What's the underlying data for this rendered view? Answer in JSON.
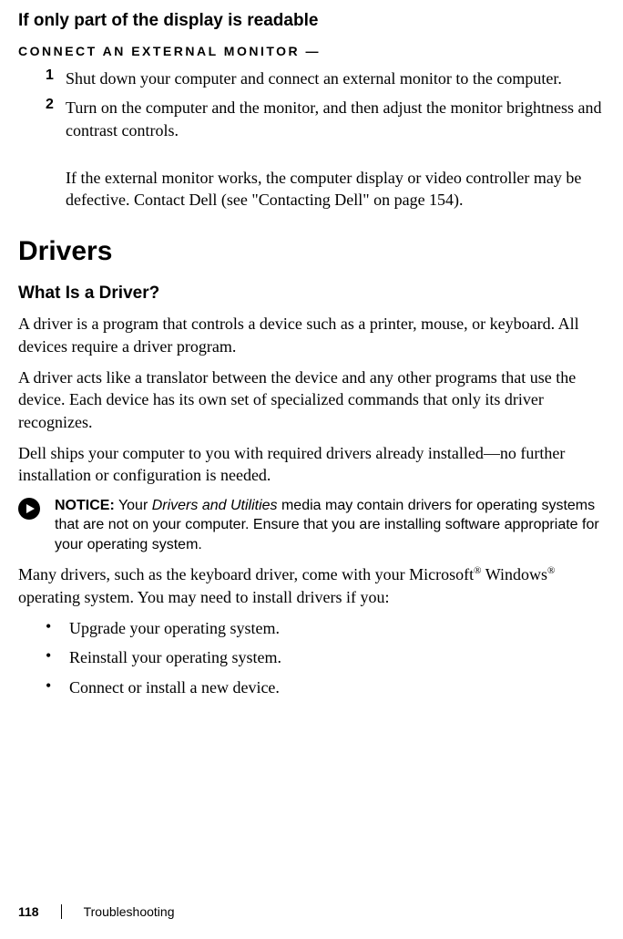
{
  "heading_sub": "If only part of the display is readable",
  "action_head": "Connect an external monitor —",
  "steps": [
    {
      "num": "1",
      "text": "Shut down your computer and connect an external monitor to the computer."
    },
    {
      "num": "2",
      "text": "Turn on the computer and the monitor, and then adjust the monitor brightness and contrast controls."
    }
  ],
  "step_followup": "If the external monitor works, the computer display or video controller may be defective. Contact Dell (see \"Contacting Dell\" on page 154).",
  "section_h1": "Drivers",
  "section_h2": "What Is a Driver?",
  "paras": [
    "A driver is a program that controls a device such as a printer, mouse, or keyboard. All devices require a driver program.",
    "A driver acts like a translator between the device and any other programs that use the device. Each device has its own set of specialized commands that only its driver recognizes.",
    "Dell ships your computer to you with required drivers already installed—no further installation or configuration is needed."
  ],
  "notice_label": "NOTICE:",
  "notice_text_pre": " Your ",
  "notice_italic": "Drivers and Utilities",
  "notice_text_post": " media may contain drivers for operating systems that are not on your computer. Ensure that you are installing software appropriate for your operating system.",
  "para_after_notice_pre": "Many drivers, such as the keyboard driver, come with your Microsoft",
  "reg": "®",
  "para_after_notice_mid": " Windows",
  "para_after_notice_post": " operating system. You may need to install drivers if you:",
  "bullets": [
    "Upgrade your operating system.",
    "Reinstall your operating system.",
    "Connect or install a new device."
  ],
  "footer_page": "118",
  "footer_section": "Troubleshooting"
}
